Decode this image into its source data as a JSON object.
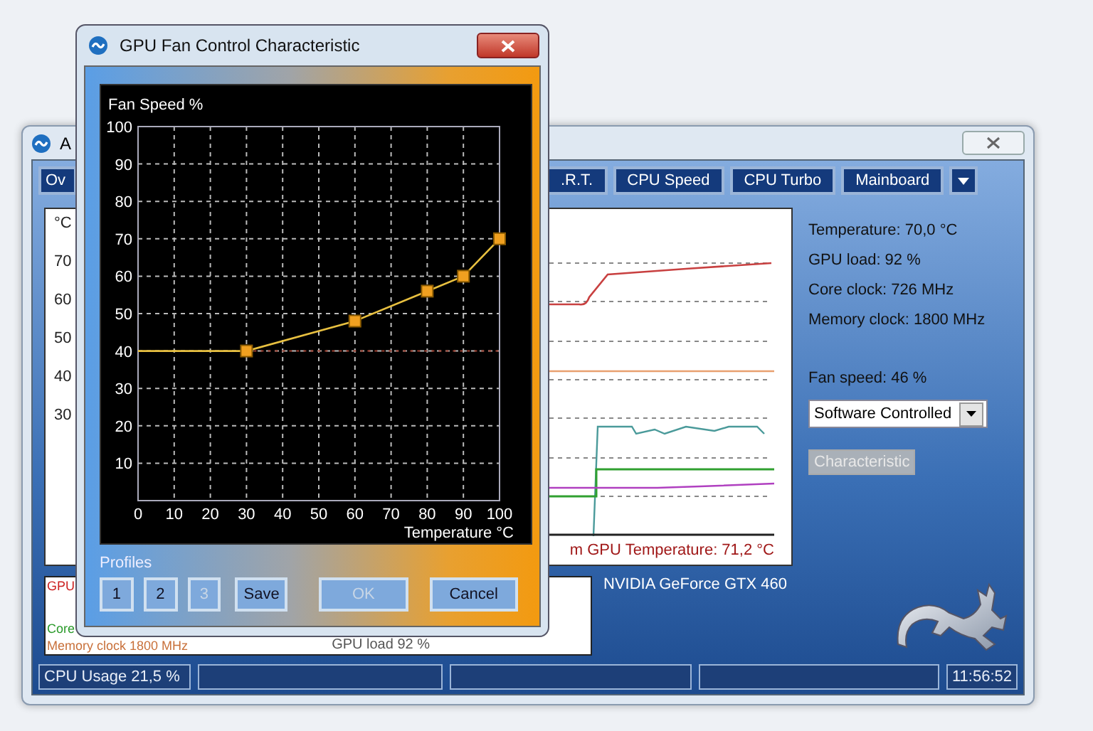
{
  "main_window": {
    "title": "A",
    "tabs": [
      {
        "label": "Ov",
        "selected": false
      },
      {
        "label": ".R.T.",
        "selected": false
      },
      {
        "label": "CPU Speed",
        "selected": false
      },
      {
        "label": "CPU Turbo",
        "selected": false
      },
      {
        "label": "Mainboard",
        "selected": false
      }
    ],
    "history_chart": {
      "unit": "°C",
      "y_labels": [
        "70",
        "60",
        "50",
        "40",
        "30"
      ],
      "caption": "m GPU Temperature: 71,2 °C"
    },
    "legend": [
      {
        "text": "GPU",
        "color": "#cc2020"
      },
      {
        "text": "Core",
        "color": "#2a9a2a"
      },
      {
        "text": "Memory clock 1800 MHz",
        "color": "#c8703a"
      }
    ],
    "legend_right": "GPU load 92 %",
    "device": "NVIDIA GeForce GTX 460",
    "readings": [
      "Temperature: 70,0 °C",
      "GPU load: 92 %",
      "Core clock: 726 MHz",
      "Memory clock: 1800 MHz"
    ],
    "fan_speed": "Fan speed: 46 %",
    "fan_mode": {
      "value": "Software Controlled"
    },
    "characteristic_button": {
      "label": "Characteristic",
      "disabled": true
    },
    "status_bar": {
      "cpu_usage": "CPU Usage 21,5 %",
      "time": "11:56:52"
    }
  },
  "dialog": {
    "title": "GPU Fan Control Characteristic",
    "chart_data": {
      "type": "line",
      "ylabel": "Fan Speed %",
      "xlabel": "Temperature °C",
      "x": [
        0,
        30,
        60,
        80,
        90,
        100
      ],
      "series": [
        {
          "color": "#e8c040",
          "marker": "square",
          "values": [
            40,
            40,
            48,
            56,
            60,
            70
          ]
        }
      ],
      "grid": true,
      "ref_lines": [
        {
          "axis": "y",
          "value": 40
        }
      ],
      "xlim": [
        0,
        100
      ],
      "ylim": [
        0,
        100
      ],
      "xticks": [
        0,
        10,
        20,
        30,
        40,
        50,
        60,
        70,
        80,
        90,
        100
      ],
      "yticks": [
        10,
        20,
        30,
        40,
        50,
        60,
        70,
        80,
        90,
        100
      ]
    },
    "profiles_label": "Profiles",
    "buttons": [
      {
        "label": "1",
        "disabled": false
      },
      {
        "label": "2",
        "disabled": false
      },
      {
        "label": "3",
        "disabled": true
      },
      {
        "label": "Save",
        "disabled": false
      },
      {
        "label": "OK",
        "disabled": true
      },
      {
        "label": "Cancel",
        "disabled": false
      }
    ]
  }
}
